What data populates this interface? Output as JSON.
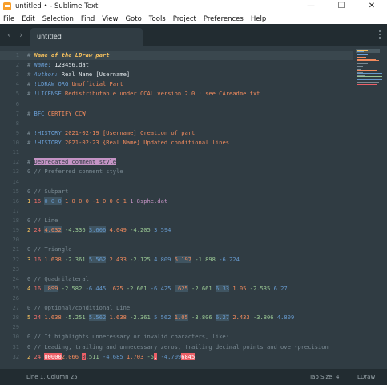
{
  "window": {
    "title": "untitled • - Sublime Text",
    "minimize_glyph": "—",
    "maximize_glyph": "☐",
    "close_glyph": "✕"
  },
  "menu": [
    "File",
    "Edit",
    "Selection",
    "Find",
    "View",
    "Goto",
    "Tools",
    "Project",
    "Preferences",
    "Help"
  ],
  "tabbar": {
    "back_glyph": "‹",
    "forward_glyph": "›",
    "tab_label": "untitled"
  },
  "editor": {
    "lines": [
      {
        "n": "1",
        "segs": [
          {
            "t": "# ",
            "c": "t-hash"
          },
          {
            "t": "Name of the LDraw part",
            "c": "t-title"
          }
        ]
      },
      {
        "n": "2",
        "segs": [
          {
            "t": "# ",
            "c": "t-hash"
          },
          {
            "t": "Name: ",
            "c": "t-key"
          },
          {
            "t": "123456.dat",
            "c": "t-val"
          }
        ]
      },
      {
        "n": "3",
        "segs": [
          {
            "t": "# ",
            "c": "t-hash"
          },
          {
            "t": "Author: ",
            "c": "t-key"
          },
          {
            "t": "Real Name [Username]",
            "c": "t-val"
          }
        ]
      },
      {
        "n": "4",
        "segs": [
          {
            "t": "# ",
            "c": "t-hash"
          },
          {
            "t": "!LDRAW_ORG ",
            "c": "t-bang"
          },
          {
            "t": "Unofficial_Part",
            "c": "t-orange"
          }
        ]
      },
      {
        "n": "5",
        "segs": [
          {
            "t": "# ",
            "c": "t-hash"
          },
          {
            "t": "!LICENSE ",
            "c": "t-bang"
          },
          {
            "t": "Redistributable under CCAL version 2.0 : see CAreadme.txt",
            "c": "t-orange"
          }
        ]
      },
      {
        "n": "6",
        "segs": []
      },
      {
        "n": "7",
        "segs": [
          {
            "t": "# ",
            "c": "t-hash"
          },
          {
            "t": "BFC ",
            "c": "t-bang"
          },
          {
            "t": "CERTIFY CCW",
            "c": "t-orange"
          }
        ]
      },
      {
        "n": "8",
        "segs": []
      },
      {
        "n": "9",
        "segs": [
          {
            "t": "# ",
            "c": "t-hash"
          },
          {
            "t": "!HISTORY ",
            "c": "t-bang"
          },
          {
            "t": "2021-02-19 [Username] Creation of part",
            "c": "t-orange"
          }
        ]
      },
      {
        "n": "10",
        "segs": [
          {
            "t": "# ",
            "c": "t-hash"
          },
          {
            "t": "!HISTORY ",
            "c": "t-bang"
          },
          {
            "t": "2021-02-23 {Real Name} Updated conditional lines",
            "c": "t-orange"
          }
        ]
      },
      {
        "n": "11",
        "segs": []
      },
      {
        "n": "12",
        "segs": [
          {
            "t": "# ",
            "c": "t-hash"
          },
          {
            "t": "Deprecated comment style",
            "c": "hl-purple"
          }
        ]
      },
      {
        "n": "13",
        "segs": [
          {
            "t": "0 ",
            "c": "t-comment"
          },
          {
            "t": "// Preferred comment style",
            "c": "t-comment"
          }
        ]
      },
      {
        "n": "14",
        "segs": []
      },
      {
        "n": "15",
        "segs": [
          {
            "t": "0 // Subpart",
            "c": "t-comment"
          }
        ]
      },
      {
        "n": "16",
        "segs": [
          {
            "t": "1 ",
            "c": "t-yellow"
          },
          {
            "t": "16 ",
            "c": "t-red"
          },
          {
            "t": "0 0 0",
            "c": "t-blue hl-box"
          },
          {
            "t": " ",
            "c": "t-val"
          },
          {
            "t": "1 0 0 0 -1 0 0 0 1",
            "c": "t-orange"
          },
          {
            "t": " 1-8sphe.dat",
            "c": "t-purple"
          }
        ]
      },
      {
        "n": "17",
        "segs": []
      },
      {
        "n": "18",
        "segs": [
          {
            "t": "0 // Line",
            "c": "t-comment"
          }
        ]
      },
      {
        "n": "19",
        "segs": [
          {
            "t": "2 ",
            "c": "t-yellow"
          },
          {
            "t": "24 ",
            "c": "t-red"
          },
          {
            "t": "4.032",
            "c": "t-orange hl-box"
          },
          {
            "t": " -4.336 ",
            "c": "t-green"
          },
          {
            "t": "3.606",
            "c": "t-blue hl-box"
          },
          {
            "t": " 4.049 ",
            "c": "t-orange"
          },
          {
            "t": "-4.205 ",
            "c": "t-green"
          },
          {
            "t": "3.594",
            "c": "t-blue"
          }
        ]
      },
      {
        "n": "20",
        "segs": []
      },
      {
        "n": "21",
        "segs": [
          {
            "t": "0 // Triangle",
            "c": "t-comment"
          }
        ]
      },
      {
        "n": "22",
        "segs": [
          {
            "t": "3 ",
            "c": "t-yellow"
          },
          {
            "t": "16 ",
            "c": "t-red"
          },
          {
            "t": "1.638",
            "c": "t-orange"
          },
          {
            "t": " -2.361 ",
            "c": "t-green"
          },
          {
            "t": "5.562",
            "c": "t-blue hl-box"
          },
          {
            "t": " 2.433 ",
            "c": "t-orange"
          },
          {
            "t": "-2.125 ",
            "c": "t-green"
          },
          {
            "t": "4.809 ",
            "c": "t-blue"
          },
          {
            "t": "5.197",
            "c": "t-orange hl-box"
          },
          {
            "t": " -1.898 ",
            "c": "t-green"
          },
          {
            "t": "-6.224",
            "c": "t-blue"
          }
        ]
      },
      {
        "n": "23",
        "segs": []
      },
      {
        "n": "24",
        "segs": [
          {
            "t": "0 // Quadrilateral",
            "c": "t-comment"
          }
        ]
      },
      {
        "n": "25",
        "segs": [
          {
            "t": "4 ",
            "c": "t-yellow"
          },
          {
            "t": "16 ",
            "c": "t-red"
          },
          {
            "t": ".899",
            "c": "t-orange hl-box"
          },
          {
            "t": " -2.582 ",
            "c": "t-green"
          },
          {
            "t": "-6.445",
            "c": "t-blue"
          },
          {
            "t": " .625 ",
            "c": "t-orange"
          },
          {
            "t": "-2.661 ",
            "c": "t-green"
          },
          {
            "t": "-6.425 ",
            "c": "t-blue"
          },
          {
            "t": ".625",
            "c": "t-orange hl-box"
          },
          {
            "t": " -2.661 ",
            "c": "t-green"
          },
          {
            "t": "6.33",
            "c": "t-blue hl-box"
          },
          {
            "t": " 1.05 ",
            "c": "t-orange"
          },
          {
            "t": "-2.535 ",
            "c": "t-green"
          },
          {
            "t": "6.27",
            "c": "t-blue"
          }
        ]
      },
      {
        "n": "26",
        "segs": []
      },
      {
        "n": "27",
        "segs": [
          {
            "t": "0 // Optional/conditional Line",
            "c": "t-comment"
          }
        ]
      },
      {
        "n": "28",
        "segs": [
          {
            "t": "5 ",
            "c": "t-yellow"
          },
          {
            "t": "24 ",
            "c": "t-red"
          },
          {
            "t": "1.638",
            "c": "t-orange"
          },
          {
            "t": " -5.251 ",
            "c": "t-green"
          },
          {
            "t": "5.562",
            "c": "t-blue hl-box"
          },
          {
            "t": " 1.638 ",
            "c": "t-orange"
          },
          {
            "t": "-2.361 ",
            "c": "t-green"
          },
          {
            "t": "5.562 ",
            "c": "t-blue"
          },
          {
            "t": "1.05",
            "c": "t-orange hl-box"
          },
          {
            "t": " -3.806 ",
            "c": "t-green"
          },
          {
            "t": "6.27",
            "c": "t-blue hl-box"
          },
          {
            "t": " 2.433 ",
            "c": "t-orange"
          },
          {
            "t": "-3.806 ",
            "c": "t-green"
          },
          {
            "t": "4.809",
            "c": "t-blue"
          }
        ]
      },
      {
        "n": "29",
        "segs": []
      },
      {
        "n": "30",
        "segs": [
          {
            "t": "0 // It highlights unnecessary or invalid characters, like:",
            "c": "t-comment"
          }
        ]
      },
      {
        "n": "31",
        "segs": [
          {
            "t": "0 // Leading, trailing and unnecessary zeros, trailing decimal points and over-precision",
            "c": "t-comment"
          }
        ]
      },
      {
        "n": "32",
        "segs": [
          {
            "t": "2 ",
            "c": "t-yellow"
          },
          {
            "t": "24 ",
            "c": "t-red"
          },
          {
            "t": "00000",
            "c": "hl-red"
          },
          {
            "t": "2.066 ",
            "c": "t-orange"
          },
          {
            "t": "0",
            "c": "hl-red-dark"
          },
          {
            "t": ".511 ",
            "c": "t-green"
          },
          {
            "t": "-4.685 ",
            "c": "t-blue"
          },
          {
            "t": "1.703 ",
            "c": "t-orange"
          },
          {
            "t": "-5",
            "c": "t-green"
          },
          {
            "t": ".",
            "c": "hl-red"
          },
          {
            "t": " -4.709",
            "c": "t-blue"
          },
          {
            "t": "6845",
            "c": "hl-red"
          }
        ]
      }
    ]
  },
  "status": {
    "position": "Line 1, Column 25",
    "tab_size": "Tab Size: 4",
    "syntax": "LDraw"
  },
  "colors": {
    "background": "#303c43",
    "tabbar": "#222c31",
    "accent_yellow": "#f7c25e",
    "accent_purple": "#c594c5",
    "error_red": "#ec5f67"
  }
}
